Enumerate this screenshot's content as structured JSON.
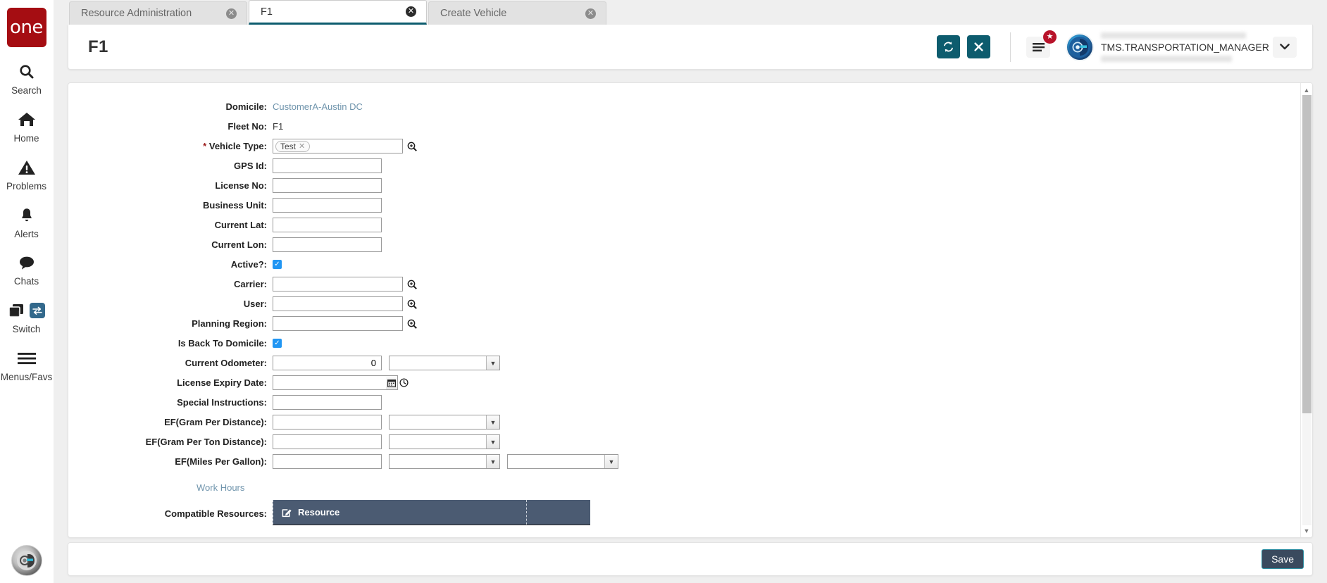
{
  "brand": {
    "logo_text": "one",
    "logo_color": "#a50d12"
  },
  "theme": {
    "accent_teal": "#0d5c6e",
    "grid_header": "#4b5b72",
    "link_blue": "#6f94ac",
    "badge_red": "#b8132a",
    "save_border": "#2e8fa3"
  },
  "sidebar": {
    "items": [
      {
        "label": "Search",
        "icon": "search-icon"
      },
      {
        "label": "Home",
        "icon": "home-icon"
      },
      {
        "label": "Problems",
        "icon": "warning-triangle-icon"
      },
      {
        "label": "Alerts",
        "icon": "bell-icon"
      },
      {
        "label": "Chats",
        "icon": "chat-bubble-icon"
      },
      {
        "label": "Switch",
        "icon": "windows-stack-icon",
        "badge_icon": "swap-arrows-icon"
      },
      {
        "label": "Menus/Favs",
        "icon": "hamburger-icon"
      }
    ],
    "bottom_avatar_icon": "assistant-robot-avatar"
  },
  "tabs": [
    {
      "label": "Resource Administration",
      "active": false,
      "close_icon": "close-circle-icon"
    },
    {
      "label": "F1",
      "active": true,
      "close_icon": "close-circle-icon"
    },
    {
      "label": "Create Vehicle",
      "active": false,
      "close_icon": "close-circle-icon"
    }
  ],
  "header": {
    "title": "F1",
    "refresh_icon": "refresh-icon",
    "close_icon": "close-x-icon",
    "menu_icon": "hamburger-menu-icon",
    "star_badge_icon": "star-icon",
    "avatar_icon": "user-avatar-icon",
    "username": "TMS.TRANSPORTATION_MANAGER",
    "caret_icon": "chevron-down-icon"
  },
  "form": {
    "fields": [
      {
        "label": "Domicile:",
        "type": "link",
        "value": "CustomerA-Austin DC"
      },
      {
        "label": "Fleet No:",
        "type": "text",
        "value": "F1"
      },
      {
        "label": "Vehicle Type:",
        "type": "token",
        "required": true,
        "token": "Test",
        "lookup_icon": "magnifier-plus-icon"
      },
      {
        "label": "GPS Id:",
        "type": "input",
        "value": ""
      },
      {
        "label": "License No:",
        "type": "input",
        "value": ""
      },
      {
        "label": "Business Unit:",
        "type": "input",
        "value": ""
      },
      {
        "label": "Current Lat:",
        "type": "input",
        "value": ""
      },
      {
        "label": "Current Lon:",
        "type": "input",
        "value": ""
      },
      {
        "label": "Active?:",
        "type": "checkbox",
        "checked": true
      },
      {
        "label": "Carrier:",
        "type": "input-lookup",
        "value": "",
        "lookup_icon": "magnifier-plus-icon"
      },
      {
        "label": "User:",
        "type": "input-lookup",
        "value": "",
        "lookup_icon": "magnifier-plus-icon"
      },
      {
        "label": "Planning Region:",
        "type": "input-lookup",
        "value": "",
        "lookup_icon": "magnifier-plus-icon"
      },
      {
        "label": "Is Back To Domicile:",
        "type": "checkbox",
        "checked": true
      },
      {
        "label": "Current Odometer:",
        "type": "input-select",
        "value": "0",
        "select_value": ""
      },
      {
        "label": "License Expiry Date:",
        "type": "datetime",
        "value": "",
        "calendar_icon": "calendar-icon",
        "clock_icon": "clock-icon"
      },
      {
        "label": "Special Instructions:",
        "type": "input",
        "value": ""
      },
      {
        "label": "EF(Gram Per Distance):",
        "type": "input-select",
        "value": "",
        "select_value": ""
      },
      {
        "label": "EF(Gram Per Ton Distance):",
        "type": "input-select",
        "value": "",
        "select_value": ""
      },
      {
        "label": "EF(Miles Per Gallon):",
        "type": "input-select-select",
        "value": "",
        "select_value": "",
        "select2_value": ""
      }
    ],
    "work_hours_link": "Work Hours",
    "compatible_resources_label": "Compatible Resources:",
    "grid": {
      "columns": [
        "Resource",
        ""
      ],
      "edit_icon": "edit-pencil-icon",
      "rows": []
    }
  },
  "footer": {
    "save_label": "Save"
  },
  "scrollbar": {
    "up_icon": "triangle-up-icon",
    "down_icon": "triangle-down-icon",
    "thumb_percent": 74
  }
}
